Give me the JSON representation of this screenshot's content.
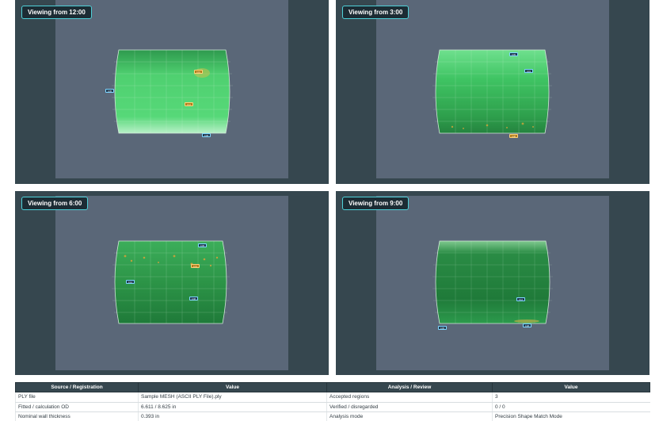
{
  "views": [
    {
      "label": "Viewing from 12:00",
      "tags": [
        "0.05",
        "0.19",
        "0.12",
        "0.08"
      ]
    },
    {
      "label": "Viewing from 3:00",
      "tags": [
        "0.05",
        "0.19",
        "0.08"
      ]
    },
    {
      "label": "Viewing from 6:00",
      "tags": [
        "0.05",
        "0.19",
        "0.12",
        "0.08"
      ]
    },
    {
      "label": "Viewing from 9:00",
      "tags": [
        "0.05",
        "0.12",
        "0.08"
      ]
    }
  ],
  "table": {
    "headers": [
      "Source / Registration",
      "Value",
      "Analysis / Review",
      "Value"
    ],
    "rows": [
      [
        "PLY file",
        "Sample MESH (ASCII PLY File).ply",
        "Accepted regions",
        "3"
      ],
      [
        "Fitted / calculation OD",
        "6.611 / 8.625 in",
        "Verified / disregarded",
        "0 / 0"
      ],
      [
        "Nominal wall thickness",
        "0.393 in",
        "Analysis mode",
        "Precision Shape Match Mode"
      ]
    ]
  },
  "colors": {
    "panel": "#36474f",
    "stage": "#5a6778",
    "label_border": "#4fd1d9",
    "mesh": "#3fbf60"
  }
}
